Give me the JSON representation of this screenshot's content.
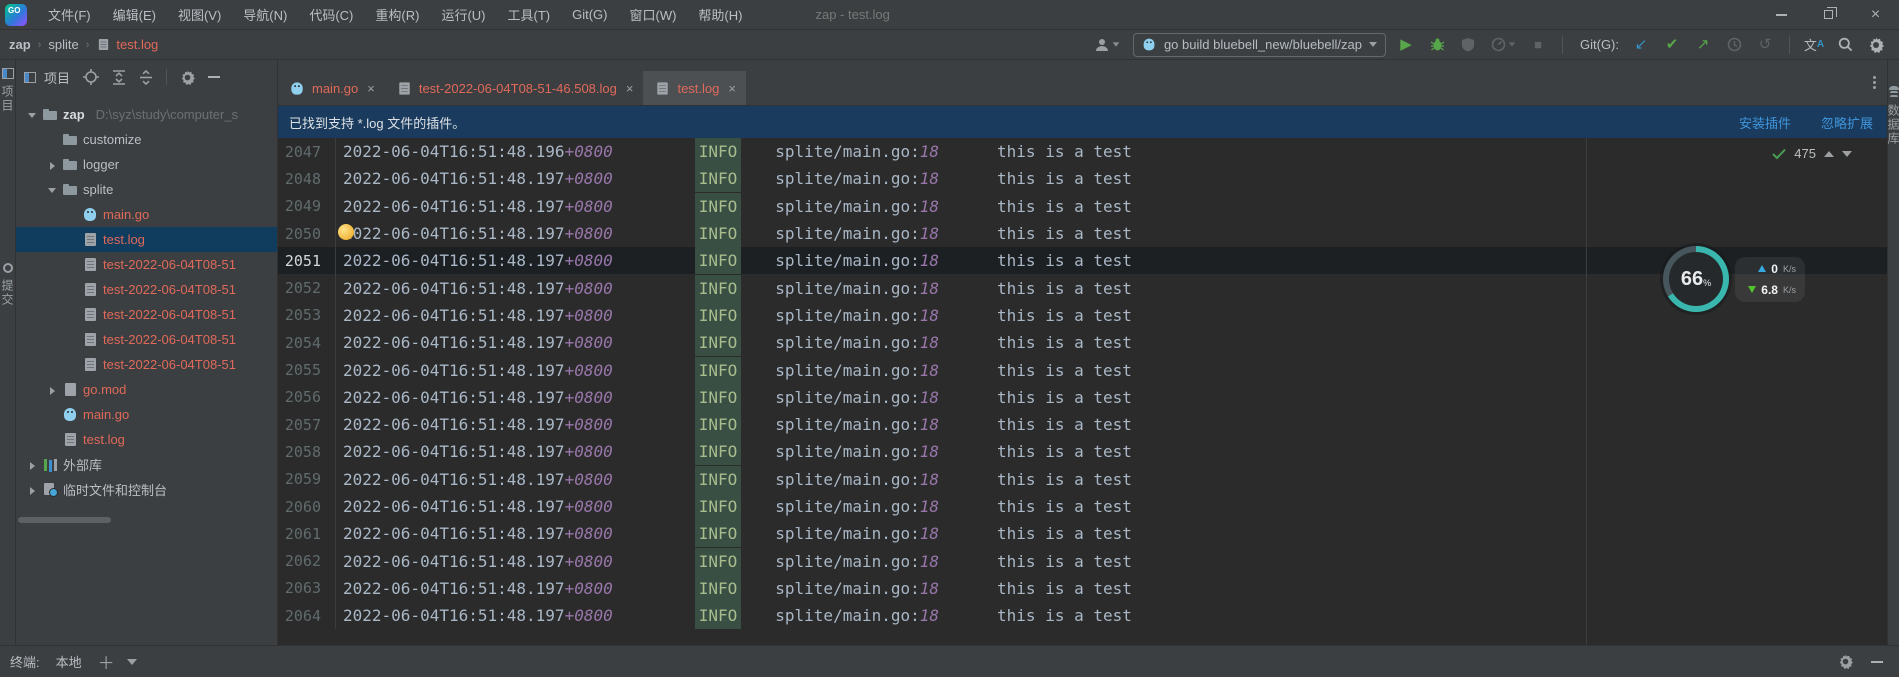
{
  "window": {
    "logo_text": "GO",
    "title": "zap - test.log",
    "menus": [
      {
        "label": "文件(F)"
      },
      {
        "label": "编辑(E)"
      },
      {
        "label": "视图(V)"
      },
      {
        "label": "导航(N)"
      },
      {
        "label": "代码(C)"
      },
      {
        "label": "重构(R)"
      },
      {
        "label": "运行(U)"
      },
      {
        "label": "工具(T)"
      },
      {
        "label": "Git(G)"
      },
      {
        "label": "窗口(W)"
      },
      {
        "label": "帮助(H)"
      }
    ]
  },
  "toolbar": {
    "breadcrumb": [
      "zap",
      "splite",
      "test.log"
    ],
    "run_config": "go build bluebell_new/bluebell/zap",
    "git_label": "Git(G):",
    "translate": {
      "cjk": "文",
      "a": "A"
    }
  },
  "stripes": {
    "left_top_label": "项目",
    "left_bottom_label": "提交",
    "right_label": "数据库"
  },
  "project": {
    "header": "项目",
    "tree": [
      {
        "ind": 0,
        "chev": "down",
        "icon": "folder",
        "label": "zap",
        "path": "D:\\syz\\study\\computer_s",
        "cls": "bold"
      },
      {
        "ind": 1,
        "icon": "folder",
        "label": "customize"
      },
      {
        "ind": 1,
        "chev": "right",
        "icon": "folder",
        "label": "logger"
      },
      {
        "ind": 1,
        "chev": "down",
        "icon": "folder",
        "label": "splite"
      },
      {
        "ind": 2,
        "icon": "gopher",
        "label": "main.go",
        "cls": "red"
      },
      {
        "ind": 2,
        "icon": "log",
        "label": "test.log",
        "cls": "red selected"
      },
      {
        "ind": 2,
        "icon": "log",
        "label": "test-2022-06-04T08-51",
        "cls": "red"
      },
      {
        "ind": 2,
        "icon": "log",
        "label": "test-2022-06-04T08-51",
        "cls": "red"
      },
      {
        "ind": 2,
        "icon": "log",
        "label": "test-2022-06-04T08-51",
        "cls": "red"
      },
      {
        "ind": 2,
        "icon": "log",
        "label": "test-2022-06-04T08-51",
        "cls": "red"
      },
      {
        "ind": 2,
        "icon": "log",
        "label": "test-2022-06-04T08-51",
        "cls": "red"
      },
      {
        "ind": 1,
        "chev": "right",
        "icon": "file",
        "label": "go.mod",
        "cls": "red"
      },
      {
        "ind": 1,
        "icon": "gopher",
        "label": "main.go",
        "cls": "red"
      },
      {
        "ind": 1,
        "icon": "log",
        "label": "test.log",
        "cls": "red"
      },
      {
        "ind": 0,
        "chev": "right",
        "icon": "lib",
        "label": "外部库"
      },
      {
        "ind": 0,
        "chev": "right",
        "icon": "scratch",
        "label": "临时文件和控制台"
      }
    ]
  },
  "editor": {
    "tabs": [
      {
        "icon": "gopher",
        "label": "main.go",
        "close": "×"
      },
      {
        "icon": "log",
        "label": "test-2022-06-04T08-51-46.508.log",
        "close": "×"
      },
      {
        "icon": "log",
        "label": "test.log",
        "close": "×",
        "cls": "active"
      }
    ],
    "banner": {
      "text": "已找到支持 *.log 文件的插件。",
      "install": "安装插件",
      "ignore": "忽略扩展"
    },
    "rows": [
      {
        "n": "2047",
        "t": "2022-06-04T16:51:48.196",
        "z": "+0800",
        "lvl": "INFO",
        "src": "splite/main.go:",
        "ln": "18",
        "msg": "this is a test"
      },
      {
        "n": "2048",
        "t": "2022-06-04T16:51:48.197",
        "z": "+0800",
        "lvl": "INFO",
        "src": "splite/main.go:",
        "ln": "18",
        "msg": "this is a test"
      },
      {
        "n": "2049",
        "t": "2022-06-04T16:51:48.197",
        "z": "+0800",
        "lvl": "INFO",
        "src": "splite/main.go:",
        "ln": "18",
        "msg": "this is a test"
      },
      {
        "n": "2050",
        "t": "2022-06-04T16:51:48.197",
        "z": "+0800",
        "lvl": "INFO",
        "src": "splite/main.go:",
        "ln": "18",
        "msg": "this is a test",
        "cls": "bulb"
      },
      {
        "n": "2051",
        "t": "2022-06-04T16:51:48.197",
        "z": "+0800",
        "lvl": "INFO",
        "src": "splite/main.go:",
        "ln": "18",
        "msg": "this is a test",
        "cls": "current"
      },
      {
        "n": "2052",
        "t": "2022-06-04T16:51:48.197",
        "z": "+0800",
        "lvl": "INFO",
        "src": "splite/main.go:",
        "ln": "18",
        "msg": "this is a test"
      },
      {
        "n": "2053",
        "t": "2022-06-04T16:51:48.197",
        "z": "+0800",
        "lvl": "INFO",
        "src": "splite/main.go:",
        "ln": "18",
        "msg": "this is a test"
      },
      {
        "n": "2054",
        "t": "2022-06-04T16:51:48.197",
        "z": "+0800",
        "lvl": "INFO",
        "src": "splite/main.go:",
        "ln": "18",
        "msg": "this is a test"
      },
      {
        "n": "2055",
        "t": "2022-06-04T16:51:48.197",
        "z": "+0800",
        "lvl": "INFO",
        "src": "splite/main.go:",
        "ln": "18",
        "msg": "this is a test"
      },
      {
        "n": "2056",
        "t": "2022-06-04T16:51:48.197",
        "z": "+0800",
        "lvl": "INFO",
        "src": "splite/main.go:",
        "ln": "18",
        "msg": "this is a test"
      },
      {
        "n": "2057",
        "t": "2022-06-04T16:51:48.197",
        "z": "+0800",
        "lvl": "INFO",
        "src": "splite/main.go:",
        "ln": "18",
        "msg": "this is a test"
      },
      {
        "n": "2058",
        "t": "2022-06-04T16:51:48.197",
        "z": "+0800",
        "lvl": "INFO",
        "src": "splite/main.go:",
        "ln": "18",
        "msg": "this is a test"
      },
      {
        "n": "2059",
        "t": "2022-06-04T16:51:48.197",
        "z": "+0800",
        "lvl": "INFO",
        "src": "splite/main.go:",
        "ln": "18",
        "msg": "this is a test"
      },
      {
        "n": "2060",
        "t": "2022-06-04T16:51:48.197",
        "z": "+0800",
        "lvl": "INFO",
        "src": "splite/main.go:",
        "ln": "18",
        "msg": "this is a test"
      },
      {
        "n": "2061",
        "t": "2022-06-04T16:51:48.197",
        "z": "+0800",
        "lvl": "INFO",
        "src": "splite/main.go:",
        "ln": "18",
        "msg": "this is a test"
      },
      {
        "n": "2062",
        "t": "2022-06-04T16:51:48.197",
        "z": "+0800",
        "lvl": "INFO",
        "src": "splite/main.go:",
        "ln": "18",
        "msg": "this is a test"
      },
      {
        "n": "2063",
        "t": "2022-06-04T16:51:48.197",
        "z": "+0800",
        "lvl": "INFO",
        "src": "splite/main.go:",
        "ln": "18",
        "msg": "this is a test"
      },
      {
        "n": "2064",
        "t": "2022-06-04T16:51:48.197",
        "z": "+0800",
        "lvl": "INFO",
        "src": "splite/main.go:",
        "ln": "18",
        "msg": "this is a test"
      }
    ]
  },
  "widgets": {
    "match_count": "475",
    "gauge": {
      "percent": "66",
      "pct_sign": "%",
      "up_value": "0",
      "up_unit": "K/s",
      "down_value": "6.8",
      "down_unit": "K/s"
    }
  },
  "terminal": {
    "label": "终端:",
    "tab": "本地"
  }
}
